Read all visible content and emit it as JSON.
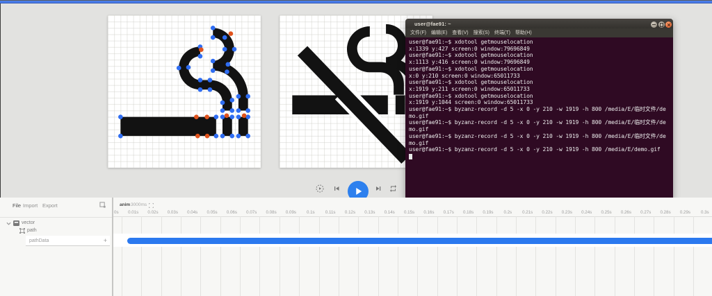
{
  "canvases": {
    "left": {
      "icon": "smoking-rooms",
      "points_blue": [
        [
          16.5,
          2
        ],
        [
          18.35,
          3.5
        ],
        [
          16.5,
          3.5
        ],
        [
          18.35,
          5.35
        ],
        [
          19.85,
          5.35
        ],
        [
          18.85,
          7.73
        ],
        [
          16.5,
          7.2
        ],
        [
          16.5,
          8.7
        ],
        [
          18.7,
          8.9
        ],
        [
          20.5,
          12.77
        ],
        [
          22,
          12.76
        ],
        [
          20.5,
          15
        ],
        [
          22,
          15
        ],
        [
          14.5,
          4.95
        ],
        [
          14.5,
          6.45
        ],
        [
          12.65,
          8.2
        ],
        [
          11.15,
          8.3
        ],
        [
          14.5,
          10.2
        ],
        [
          16.03,
          10.2
        ],
        [
          14.5,
          11.7
        ],
        [
          16.03,
          11.7
        ],
        [
          18,
          13.75
        ],
        [
          19.5,
          13.36
        ],
        [
          18,
          15
        ],
        [
          19.5,
          15
        ],
        [
          2,
          16
        ],
        [
          2,
          19
        ],
        [
          17,
          16
        ],
        [
          17,
          19
        ],
        [
          18,
          16
        ],
        [
          19.5,
          16
        ],
        [
          18,
          19
        ],
        [
          19.5,
          19
        ],
        [
          20.5,
          16
        ],
        [
          22,
          16
        ],
        [
          20.5,
          19
        ],
        [
          22,
          19
        ]
      ],
      "points_orange": [
        [
          19.3,
          2.9
        ],
        [
          14.65,
          5.42
        ],
        [
          13.9,
          16
        ],
        [
          15.56,
          16
        ],
        [
          14.1,
          19
        ],
        [
          15.6,
          19
        ],
        [
          18.65,
          15.8
        ],
        [
          21.4,
          15.8
        ]
      ],
      "point_color_blue": "#2f6df2",
      "point_color_orange": "#e0531d"
    },
    "right": {
      "icon": "smoke-free"
    }
  },
  "playback": {
    "slow_motion_label": "slow-motion-video",
    "skip_previous_label": "skip-previous",
    "play_label": "play",
    "skip_next_label": "skip-next",
    "repeat_label": "repeat",
    "play_color": "#2d80ee"
  },
  "terminal": {
    "title": "user@fae91: ~",
    "menu": [
      "文件(F)",
      "编辑(E)",
      "查看(V)",
      "搜索(S)",
      "终端(T)",
      "帮助(H)"
    ],
    "lines": [
      "user@fae91:~$ xdotool getmouselocation",
      "x:1339 y:427 screen:0 window:79696849",
      "user@fae91:~$ xdotool getmouselocation",
      "x:1113 y:416 screen:0 window:79696849",
      "user@fae91:~$ xdotool getmouselocation",
      "x:0 y:210 screen:0 window:65011733",
      "user@fae91:~$ xdotool getmouselocation",
      "x:1919 y:211 screen:0 window:65011733",
      "user@fae91:~$ xdotool getmouselocation",
      "x:1919 y:1044 screen:0 window:65011733",
      "user@fae91:~$ byzanz-record -d 5 -x 0 -y 210 -w 1919 -h 800 /media/E/临时文件/de",
      "mo.gif",
      "user@fae91:~$ byzanz-record -d 5 -x 0 -y 210 -w 1919 -h 800 /media/E/临时文件/de",
      "mo.gif",
      "user@fae91:~$ byzanz-record -d 5 -x 0 -y 210 -w 1919 -h 800 /media/E/临时文件/de",
      "mo.gif",
      "user@fae91:~$ byzanz-record -d 5 -x 0 -y 210 -w 1919 -h 800 /media/E/demo.gif"
    ],
    "body_color": "#2f0a23",
    "titlebar_color": "#3a3833",
    "close_color": "#e8602c"
  },
  "panel": {
    "menu": {
      "file": "File",
      "import": "Import",
      "export": "Export"
    },
    "tree": {
      "vector": "vector",
      "path": "path",
      "path_data": "pathData",
      "add": "+"
    },
    "timeline": {
      "name": "anim",
      "duration": "3000ms",
      "ticks": [
        "0s",
        "0.01s",
        "0.02s",
        "0.03s",
        "0.04s",
        "0.05s",
        "0.06s",
        "0.07s",
        "0.08s",
        "0.09s",
        "0.1s",
        "0.11s",
        "0.12s",
        "0.13s",
        "0.14s",
        "0.15s",
        "0.16s",
        "0.17s",
        "0.18s",
        "0.19s",
        "0.2s",
        "0.21s",
        "0.22s",
        "0.23s",
        "0.24s",
        "0.25s",
        "0.26s",
        "0.27s",
        "0.28s",
        "0.29s",
        "0.3s"
      ],
      "bar_color": "#2b79ef"
    }
  }
}
